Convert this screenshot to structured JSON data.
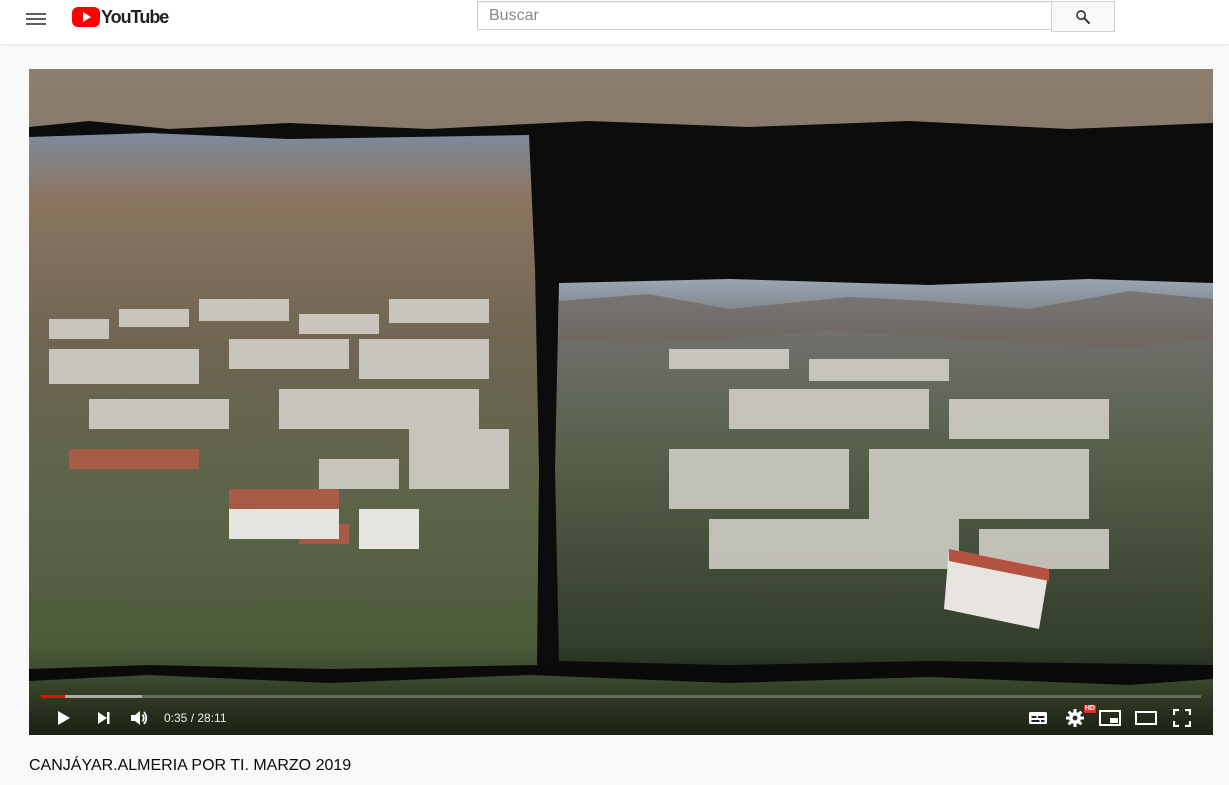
{
  "header": {
    "logo_text": "YouTube",
    "search": {
      "placeholder": "Buscar",
      "value": ""
    },
    "icons": {
      "menu": "hamburger-menu-icon",
      "search": "search-icon",
      "logo": "youtube-play-icon"
    }
  },
  "player": {
    "current_time": "0:35",
    "duration": "28:11",
    "time_display": "0:35 / 28:11",
    "played_fraction": 0.021,
    "buffered_fraction": 0.087,
    "quality_badge": "HD",
    "progress_color": "#ff0000",
    "controls": {
      "left": [
        "play-icon",
        "next-icon",
        "volume-icon"
      ],
      "right": [
        "subtitles-icon",
        "settings-icon",
        "miniplayer-icon",
        "theater-mode-icon",
        "fullscreen-icon"
      ]
    }
  },
  "video": {
    "title": "CANJÁYAR.ALMERIA POR TI. MARZO 2019"
  }
}
